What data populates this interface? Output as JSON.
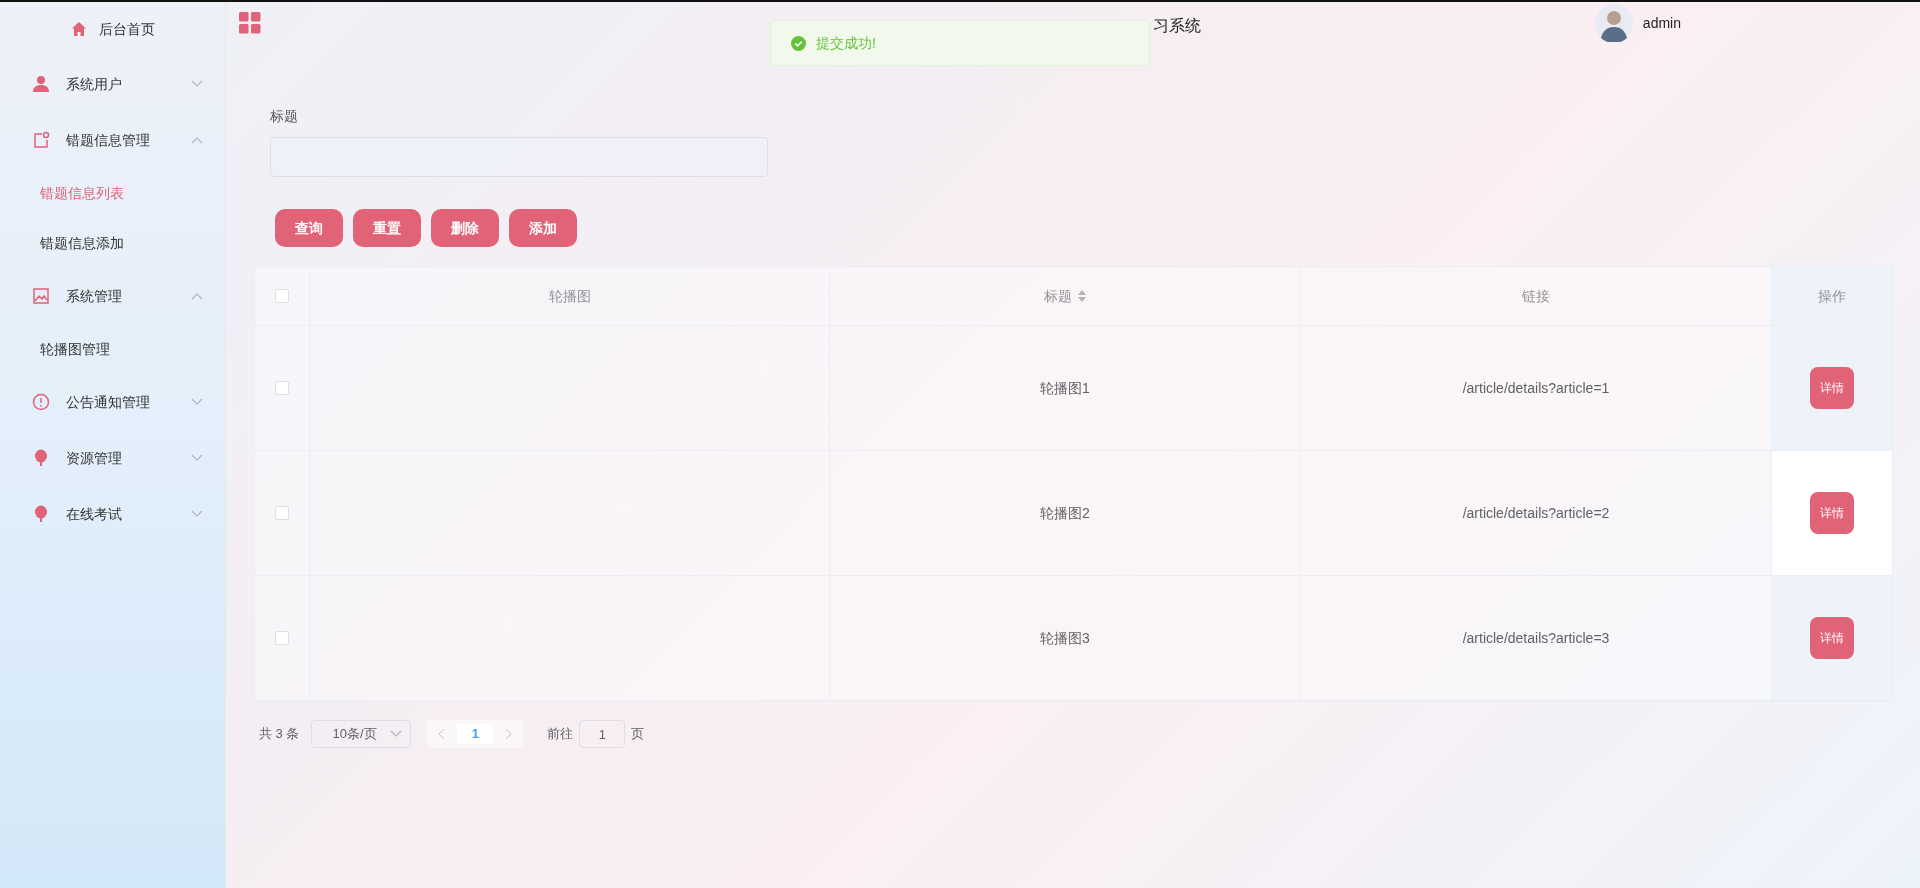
{
  "header": {
    "home": "后台首页",
    "title": "习系统",
    "user": "admin"
  },
  "toast": {
    "text": "提交成功!"
  },
  "sidebar": {
    "items": [
      {
        "label": "系统用户",
        "expanded": false
      },
      {
        "label": "错题信息管理",
        "expanded": true,
        "children": [
          {
            "label": "错题信息列表",
            "selected": true
          },
          {
            "label": "错题信息添加",
            "selected": false
          }
        ]
      },
      {
        "label": "系统管理",
        "expanded": true,
        "children": [
          {
            "label": "轮播图管理",
            "selected": false
          }
        ]
      },
      {
        "label": "公告通知管理",
        "expanded": false
      },
      {
        "label": "资源管理",
        "expanded": false
      },
      {
        "label": "在线考试",
        "expanded": false
      }
    ]
  },
  "search": {
    "label": "标题"
  },
  "buttons": [
    "查询",
    "重置",
    "删除",
    "添加"
  ],
  "table": {
    "select_all": {
      "checked": false
    },
    "columns": [
      {
        "label": "轮播图",
        "sortable": false
      },
      {
        "label": "标题",
        "sortable": true
      },
      {
        "label": "链接",
        "sortable": false
      },
      {
        "label": "操作",
        "sortable": false
      }
    ],
    "rows": [
      {
        "checked": false,
        "title": "轮播图1",
        "link": "/article/details?article=1",
        "action": "详情"
      },
      {
        "checked": false,
        "title": "轮播图2",
        "link": "/article/details?article=2",
        "action": "详情"
      },
      {
        "checked": false,
        "title": "轮播图3",
        "link": "/article/details?article=3",
        "action": "详情"
      }
    ]
  },
  "pagination": {
    "total": "共 3 条",
    "page_size": "10条/页",
    "pages": [
      {
        "label": "1",
        "selected": true
      }
    ],
    "goto_label": "前往",
    "goto_value": "1",
    "page_unit": "页"
  }
}
